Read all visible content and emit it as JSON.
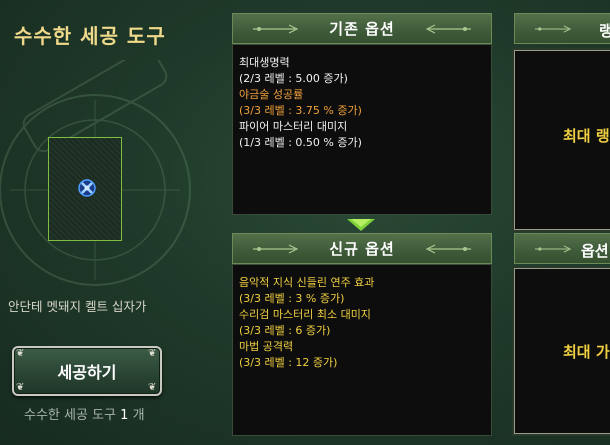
{
  "left": {
    "title": "수수한 세공 도구",
    "item_name": "안단테 멧돼지 켈트 십자가",
    "craft_button": "세공하기",
    "count_prefix": "수수한 세공 도구",
    "count_value": "1",
    "count_suffix": "개"
  },
  "existing": {
    "header": "기존 옵션",
    "lines": [
      {
        "text": "최대생명력",
        "color": "white"
      },
      {
        "text": "(2/3 레벨 : 5.00 증가)",
        "color": "white"
      },
      {
        "text": "야금술 성공률",
        "color": "orange"
      },
      {
        "text": "(3/3 레벨 : 3.75 % 증가)",
        "color": "orange"
      },
      {
        "text": "파이어 마스터리 대미지",
        "color": "white"
      },
      {
        "text": "(1/3 레벨 : 0.50 % 증가)",
        "color": "white"
      }
    ]
  },
  "new": {
    "header": "신규 옵션",
    "lines": [
      {
        "text": "음악적 지식 신들린 연주 효과",
        "color": "yellow"
      },
      {
        "text": "(3/3 레벨 : 3 % 증가)",
        "color": "yellow"
      },
      {
        "text": "수리검 마스터리 최소 대미지",
        "color": "yellow"
      },
      {
        "text": "(3/3 레벨 : 6 증가)",
        "color": "yellow"
      },
      {
        "text": "마법 공격력",
        "color": "yellow"
      },
      {
        "text": "(3/3 레벨 : 12 증가)",
        "color": "yellow"
      }
    ]
  },
  "right_top": {
    "header": "랭",
    "body": "최대 랭"
  },
  "right_bottom": {
    "header": "옵션",
    "body": "최대 가"
  },
  "colors": {
    "accent_gold": "#f0d98a",
    "orange": "#f0a03a",
    "yellow": "#f0d040",
    "arrow": "#7fd23a"
  }
}
